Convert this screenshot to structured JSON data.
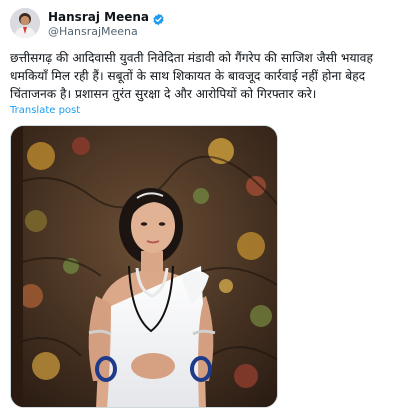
{
  "author": {
    "name": "Hansraj Meena",
    "handle": "@HansrajMeena",
    "verified_icon": "verified-badge-icon",
    "badge_color": "#1d9bf0"
  },
  "post": {
    "text": "छत्तीसगढ़ की आदिवासी युवती निवेदिता मंडावी को गैंगरेप की साजिश जैसी भयावह धमकियाँ मिल रही हैं। सबूतों के साथ शिकायत के बावजूद कार्रवाई नहीं होना बेहद चिंताजनक है। प्रशासन तुरंत सुरक्षा दे और आरोपियों को गिरफ्तार करे।",
    "translate_label": "Translate post"
  },
  "colors": {
    "link": "#1d9bf0",
    "secondary_text": "#536471",
    "border": "#cfd9de"
  }
}
